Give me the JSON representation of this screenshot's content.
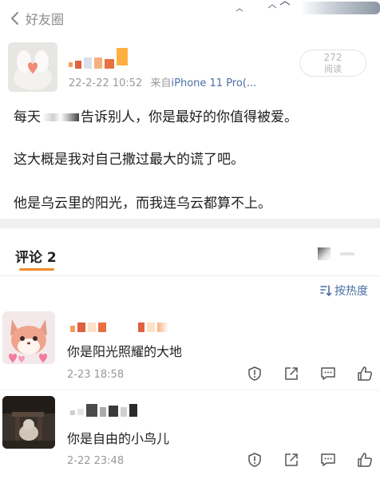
{
  "nav": {
    "back_label": "好友圈"
  },
  "post": {
    "date": "22-2-22 10:52",
    "source_prefix": "来自",
    "source": "iPhone 11 Pro(...",
    "views_count": "272",
    "views_label": "阅读",
    "text_line1_start": "每天",
    "text_line1_end": "告诉别人，你是最好的你值得被爱。",
    "text_line2": "这大概是我对自己撒过最大的谎了吧。",
    "text_line3": "他是乌云里的阳光，而我连乌云都算不上。"
  },
  "comments_header": {
    "tab_label": "评论 2",
    "sort_label": "按热度"
  },
  "comments": [
    {
      "text": "你是阳光照耀的大地",
      "time": "2-23 18:58"
    },
    {
      "text": "你是自由的小鸟儿",
      "time": "2-22 23:48"
    }
  ],
  "colors": {
    "accent": "#f08a2a",
    "link": "#4a6fa5",
    "muted": "#999999"
  },
  "icons": {
    "back": "chevron-left-icon",
    "sort": "sort-icon",
    "report": "shield-exclamation-icon",
    "share": "share-icon",
    "reply": "comment-icon",
    "like": "thumbs-up-icon"
  }
}
